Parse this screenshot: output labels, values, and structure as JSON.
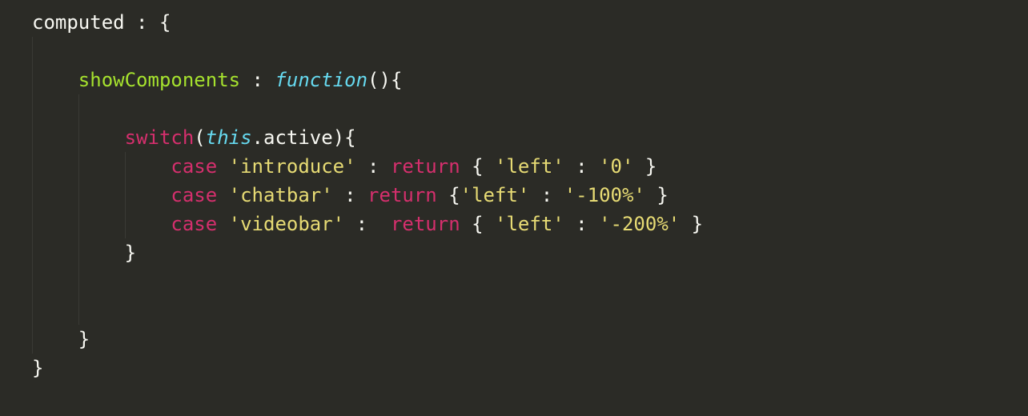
{
  "code": {
    "line1_computed": "computed",
    "line1_colon_brace": " : {",
    "line3_showComponents": "showComponents",
    "line3_colon": " : ",
    "line3_function": "function",
    "line3_parens_brace": "(){",
    "line5_switch": "switch",
    "line5_open_paren": "(",
    "line5_this": "this",
    "line5_dot_active": ".active){",
    "line6_case": "case",
    "line6_str": "'introduce'",
    "line6_colon": " : ",
    "line6_return": "return",
    "line6_brace_open": " { ",
    "line6_left": "'left'",
    "line6_colon2": " : ",
    "line6_zero": "'0'",
    "line6_brace_close": " }",
    "line7_case": "case",
    "line7_str": "'chatbar'",
    "line7_colon": " : ",
    "line7_return": "return",
    "line7_brace_open": " {",
    "line7_left": "'left'",
    "line7_colon2": " : ",
    "line7_val": "'-100%'",
    "line7_brace_close": " }",
    "line8_case": "case",
    "line8_str": "'videobar'",
    "line8_colon": " : ",
    "line8_space": " ",
    "line8_return": "return",
    "line8_brace_open": " { ",
    "line8_left": "'left'",
    "line8_colon2": " : ",
    "line8_val": "'-200%'",
    "line8_brace_close": " }",
    "line9_brace": "}",
    "line12_brace": "}",
    "line13_brace": "}"
  }
}
